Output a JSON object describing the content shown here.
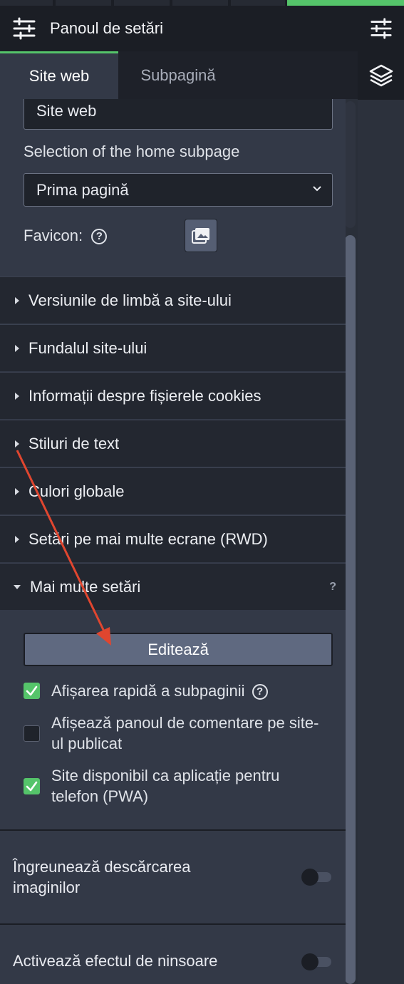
{
  "header": {
    "title": "Panoul de setări",
    "settings_icon": "sliders-icon"
  },
  "rail": {
    "top_icon": "sliders-icon",
    "layers_icon": "layers-icon"
  },
  "tabs": [
    {
      "label": "Site web"
    },
    {
      "label": "Subpagină"
    }
  ],
  "site_name_value": "Site web",
  "home_subpage": {
    "label": "Selection of the home subpage",
    "value": "Prima pagină"
  },
  "favicon": {
    "label": "Favicon:",
    "help_icon": "question-circle-icon",
    "upload_icon": "image-folder-icon"
  },
  "accordion": [
    {
      "label": "Versiunile de limbă a site-ului",
      "expanded": false
    },
    {
      "label": "Fundalul site-ului",
      "expanded": false
    },
    {
      "label": "Informații despre fișierele cookies",
      "expanded": false
    },
    {
      "label": "Stiluri de text",
      "expanded": false
    },
    {
      "label": "Culori globale",
      "expanded": false
    },
    {
      "label": "Setări pe mai multe ecrane (RWD)",
      "expanded": false
    },
    {
      "label": "Mai multe setări",
      "expanded": true,
      "help": "?"
    }
  ],
  "more_settings": {
    "edit_button": "Editează",
    "checkboxes": [
      {
        "label": "Afișarea rapidă a subpaginii",
        "checked": true
      },
      {
        "label": "Afișează panoul de comentare pe site-ul publicat",
        "checked": false
      },
      {
        "label": "Site disponibil ca aplicație pentru telefon (PWA)",
        "checked": true
      }
    ]
  },
  "toggles": [
    {
      "label": "Îngreunează descărcarea imaginilor",
      "on": false
    },
    {
      "label": "Activează efectul de ninsoare",
      "on": false
    }
  ],
  "colors": {
    "accent": "#55c46a",
    "annotation_arrow": "#e0462f"
  }
}
